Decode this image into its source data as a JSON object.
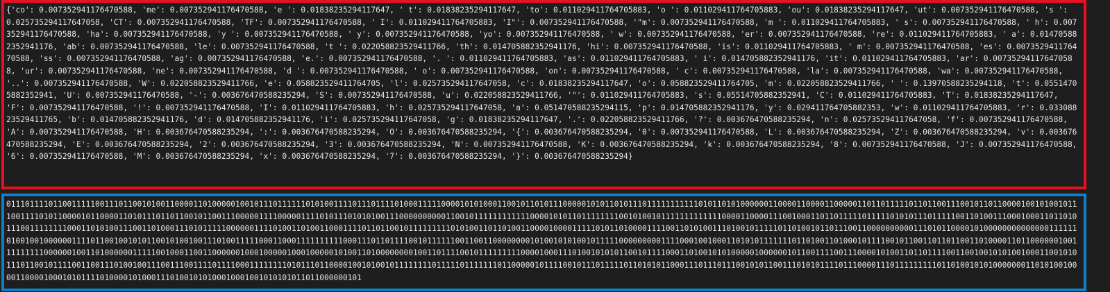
{
  "dict_output": {
    "text": "{'co': 0.007352941176470588, 'me': 0.007352941176470588, 'e ': 0.01838235294117647, ' t': 0.01838235294117647, 'to': 0.011029411764705883, 'o ': 0.011029411764705883, 'ou': 0.01838235294117647, 'ut': 0.007352941176470588, 's ': 0.025735294117647058, 'CT': 0.007352941176470588, 'TF': 0.007352941176470588, ' I': 0.011029411764705883, 'I\"': 0.007352941176470588, '\"m': 0.007352941176470588, 'm ': 0.011029411764705883, ' s': 0.007352941176470588, ' h': 0.007352941176470588, 'ha': 0.007352941176470588, 'y ': 0.007352941176470588, ' y': 0.007352941176470588, 'yo': 0.007352941176470588, ' w': 0.007352941176470588, 'er': 0.007352941176470588, 're': 0.011029411764705883, ' a': 0.014705882352941176, 'ab': 0.007352941176470588, 'le': 0.007352941176470588, 't ': 0.022058823529411766, 'th': 0.014705882352941176, 'hi': 0.007352941176470588, 'is': 0.011029411764705883, ' m': 0.007352941176470588, 'es': 0.007352941176470588, 'ss': 0.007352941176470588, 'ag': 0.007352941176470588, 'e.': 0.007352941176470588, '. ': 0.011029411764705883, 'as': 0.011029411764705883, ' i': 0.014705882352941176, 'it': 0.011029411764705883, 'ar': 0.007352941176470588, 'ur': 0.007352941176470588, 'ne': 0.007352941176470588, 'd ': 0.007352941176470588, ' o': 0.007352941176470588, 'on': 0.007352941176470588, ' c': 0.007352941176470588, 'la': 0.007352941176470588, 'wa': 0.007352941176470588, '..': 0.007352941176470588, 'W': 0.022058823529411766, 'e': 0.058823529411764705, 'l': 0.025735294117647058, 'c': 0.01838235294117647, 'o': 0.058823529411764705, 'm': 0.022058823529411766, ' ': 0.13970588235294118, 't': 0.05514705882352941, 'U': 0.007352941176470588, '-': 0.003676470588235294, 'S': 0.007352941176470588, 'u': 0.022058823529411766, '\"': 0.011029411764705883, 's': 0.05514705882352941, 'C': 0.011029411764705883, 'T': 0.01838235294117647, 'F': 0.007352941176470588, '!': 0.007352941176470588, 'I': 0.011029411764705883, 'h': 0.025735294117647058, 'a': 0.051470588235294115, 'p': 0.014705882352941176, 'y': 0.029411764705882353, 'w': 0.011029411764705883, 'r': 0.03308823529411765, 'b': 0.014705882352941176, 'd': 0.014705882352941176, 'i': 0.025735294117647058, 'g': 0.01838235294117647, '.': 0.022058823529411766, '?': 0.003676470588235294, 'n': 0.025735294117647058, 'f': 0.007352941176470588, 'A': 0.007352941176470588, 'H': 0.003676470588235294, ':': 0.003676470588235294, 'O': 0.003676470588235294, '{': 0.003676470588235294, '0': 0.007352941176470588, 'L': 0.003676470588235294, 'Z': 0.003676470588235294, 'v': 0.003676470588235294, 'E': 0.003676470588235294, '2': 0.003676470588235294, '3': 0.003676470588235294, 'N': 0.007352941176470588, 'K': 0.003676470588235294, 'k': 0.003676470588235294, '8': 0.007352941176470588, 'J': 0.007352941176470588, '6': 0.007352941176470588, 'M': 0.003676470588235294, 'x': 0.003676470588235294, '7': 0.003676470588235294, '}': 0.003676470588235294}"
  },
  "binary_output": {
    "text": "0111011110110011111001110110010100110000110100000100101110111111010100111101110111101000111110000101010001100101101011100000101011010111011111111111010110101000000110000110000110000011011011111011011001110010110110000100101001011100111101011000010110000110101110110110010110011100000111100000111101011101010100111000000000011001011111111111100001010110111111110010100101111111111111000011000011100100011011011111011111010101110111110011010011100010001101101011100111111110001101010011100110100011101011111000000111101001101001100011110110110010111111111010100110110100110000100001111101011010000111100110101001110100101111101101001011011100110000000000111010110000101000000000000001111110100100100000011110110010010101100101001001110100111110001100011111111110001110110111100101111110011001100000000101001010100101111100000000011110001001000110101011111110110100110100010111100101100110110110011010000110110000001001111111110000001001101000000111110010001100110000001000100000100010000010100110100000000100110111100101111111110000100011101001010101100101111000110100101010000010000001011001111001110000101001101101111001100100101010010001100101011101100101111001100111010010011100111001111011110001111111101011101100001001010010111111110111110111111101100000101111001011101111101101010110001110111011100101011001110101011110111000011101111111110110100101010000000110101001000011000010001010111101000010100011101001010100010001001010101011011000000101"
  }
}
